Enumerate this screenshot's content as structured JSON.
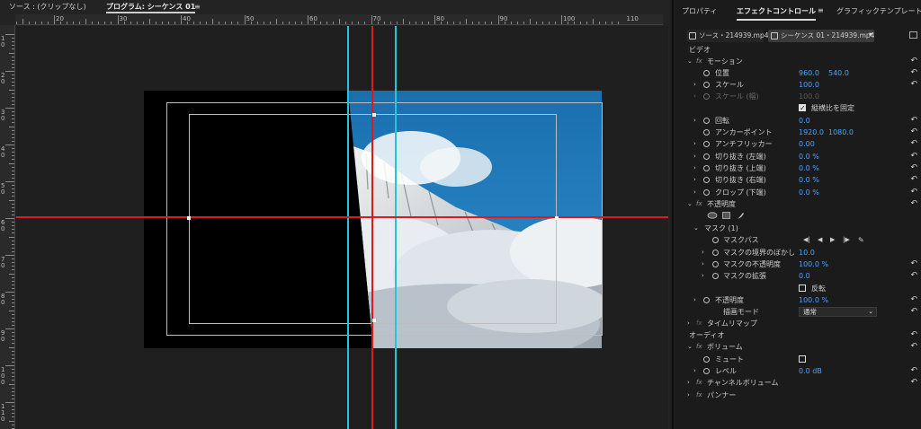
{
  "left_tabs": {
    "source": "ソース : (クリップなし)",
    "program": "プログラム: シーケンス 01",
    "program_menu": "≡"
  },
  "ruler": {
    "h_labels": [
      "20",
      "30",
      "40",
      "50",
      "60",
      "70",
      "80",
      "90",
      "100",
      "110"
    ],
    "v_labels": [
      "10",
      "20",
      "30",
      "40",
      "50",
      "60",
      "70",
      "80",
      "90",
      "100",
      "110"
    ]
  },
  "right_tabs": {
    "properties": "プロパティ",
    "effect_controls": "エフェクトコントロール",
    "menu": "≡",
    "graphics": "グラフィックテンプレート"
  },
  "source_bar": {
    "source_clip": "ソース・214939.mp4",
    "sequence_clip": "シーケンス 01・214939.mp4"
  },
  "sections": {
    "video": "ビデオ",
    "audio": "オーディオ"
  },
  "effects": {
    "motion": "モーション",
    "position": {
      "label": "位置",
      "x": "960.0",
      "y": "540.0"
    },
    "scale": {
      "label": "スケール",
      "value": "100.0"
    },
    "scale_width": {
      "label": "スケール (幅)",
      "value": "100.0"
    },
    "uniform_scale": "縦横比を固定",
    "rotation": {
      "label": "回転",
      "value": "0.0"
    },
    "anchor": {
      "label": "アンカーポイント",
      "x": "1920.0",
      "y": "1080.0"
    },
    "antiflicker": {
      "label": "アンチフリッカー",
      "value": "0.00"
    },
    "crop_left": {
      "label": "切り抜き (左端)",
      "value": "0.0 %"
    },
    "crop_top": {
      "label": "切り抜き (上端)",
      "value": "0.0 %"
    },
    "crop_right": {
      "label": "切り抜き (右端)",
      "value": "0.0 %"
    },
    "crop_bottom": {
      "label": "クロップ (下端)",
      "value": "0.0 %"
    },
    "opacity_section": "不透明度",
    "mask": "マスク (1)",
    "mask_path": "マスクパス",
    "mask_feather": {
      "label": "マスクの境界のぼかし",
      "value": "10.0"
    },
    "mask_opacity": {
      "label": "マスクの不透明度",
      "value": "100.0 %"
    },
    "mask_expansion": {
      "label": "マスクの拡張",
      "value": "0.0"
    },
    "inverted": "反転",
    "opacity": {
      "label": "不透明度",
      "value": "100.0 %"
    },
    "blend_mode": {
      "label": "描画モード",
      "value": "通常"
    },
    "time_remap": "タイムリマップ",
    "volume": "ボリューム",
    "mute": "ミュート",
    "level": {
      "label": "レベル",
      "value": "0.0 dB"
    },
    "channel_volume": "チャンネルボリューム",
    "panner": "パンナー"
  },
  "icons": {
    "reset": "reset-icon",
    "fx": "fx",
    "stopwatch": "stopwatch-icon"
  },
  "colors": {
    "value_blue": "#4aa3ff",
    "guide_cyan": "#22c6d6",
    "guide_red": "#e01a1a",
    "sky": "#1d79b6"
  }
}
